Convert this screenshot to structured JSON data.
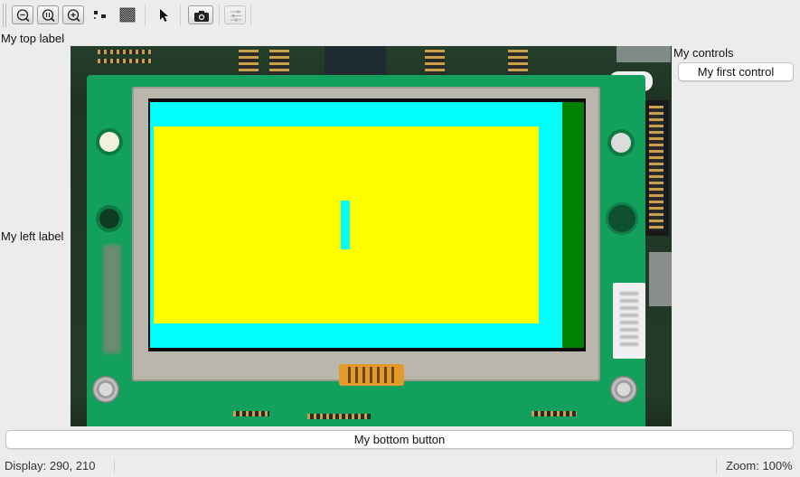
{
  "toolbar": {
    "items": [
      {
        "name": "zoom-out-icon"
      },
      {
        "name": "zoom-reset-icon"
      },
      {
        "name": "zoom-in-icon"
      },
      {
        "name": "pixel-grid-icon"
      },
      {
        "name": "checker-pattern-icon"
      },
      {
        "name": "pointer-icon"
      },
      {
        "name": "camera-icon"
      },
      {
        "name": "settings-sliders-icon"
      }
    ]
  },
  "labels": {
    "top": "My top label",
    "left": "My left label",
    "controls_heading": "My controls"
  },
  "controls": {
    "first_control": "My first control",
    "bottom_button": "My bottom button"
  },
  "display": {
    "colors": {
      "yellow": "#ffff00",
      "cyan": "#00ffff",
      "green": "#008000",
      "pcb": "#12a05c",
      "flex": "#e39a2a"
    }
  },
  "status": {
    "display": "Display: 290, 210",
    "zoom": "Zoom: 100%"
  }
}
